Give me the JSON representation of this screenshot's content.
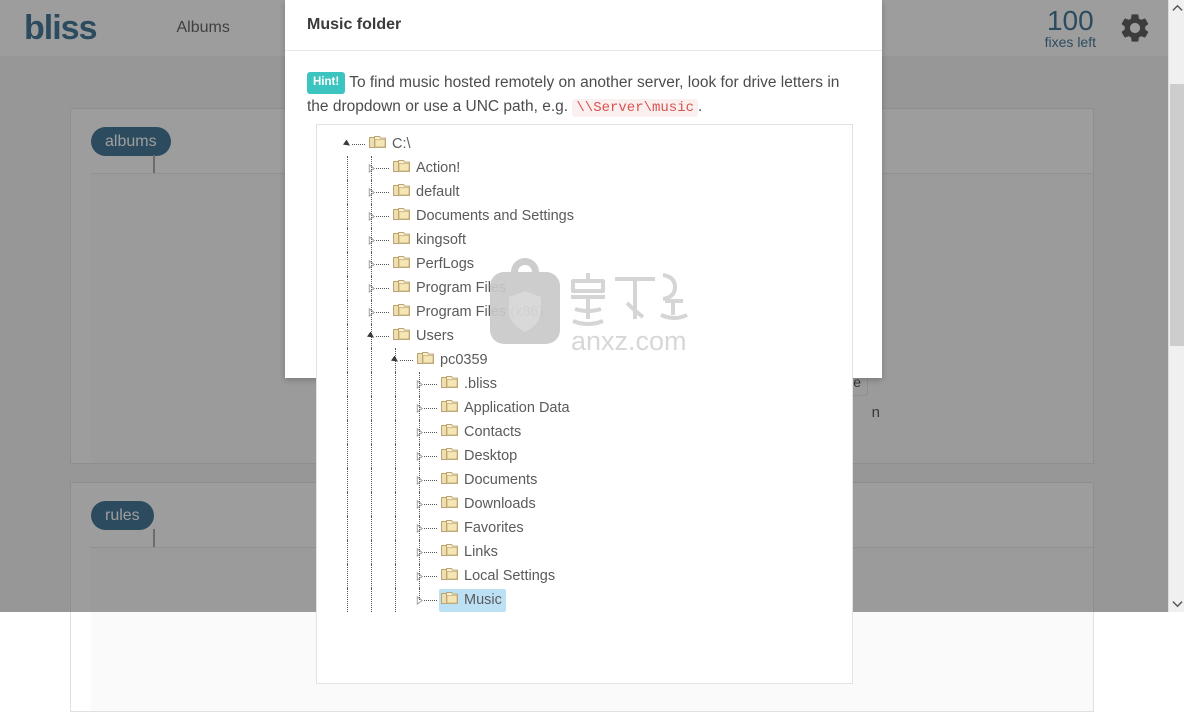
{
  "header": {
    "logo": "bliss",
    "nav_albums": "Albums",
    "fixes_count": "100",
    "fixes_label": "fixes left",
    "gear_icon": "gear-icon"
  },
  "page": {
    "albums_badge": "albums",
    "rules_badge": "rules",
    "bg_fragment_chip": "e",
    "bg_fragment_text": "n"
  },
  "modal": {
    "title": "Music folder",
    "hint_badge": "Hint!",
    "hint_text_before": "To find music hosted remotely on another server, look for drive letters in the dropdown or use a UNC path, e.g.",
    "hint_code": "\\\\Server\\music",
    "hint_text_after": "."
  },
  "tree": {
    "nodes": [
      {
        "label": "C:\\",
        "depth": 0,
        "state": "expanded",
        "selected": false
      },
      {
        "label": "Action!",
        "depth": 1,
        "state": "collapsed",
        "selected": false
      },
      {
        "label": "default",
        "depth": 1,
        "state": "collapsed",
        "selected": false
      },
      {
        "label": "Documents and Settings",
        "depth": 1,
        "state": "collapsed",
        "selected": false
      },
      {
        "label": "kingsoft",
        "depth": 1,
        "state": "collapsed",
        "selected": false
      },
      {
        "label": "PerfLogs",
        "depth": 1,
        "state": "collapsed",
        "selected": false
      },
      {
        "label": "Program Files",
        "depth": 1,
        "state": "collapsed",
        "selected": false
      },
      {
        "label": "Program Files (x86)",
        "depth": 1,
        "state": "collapsed",
        "selected": false
      },
      {
        "label": "Users",
        "depth": 1,
        "state": "expanded",
        "selected": false
      },
      {
        "label": "pc0359",
        "depth": 2,
        "state": "expanded",
        "selected": false
      },
      {
        "label": ".bliss",
        "depth": 3,
        "state": "collapsed",
        "selected": false
      },
      {
        "label": "Application Data",
        "depth": 3,
        "state": "collapsed",
        "selected": false
      },
      {
        "label": "Contacts",
        "depth": 3,
        "state": "collapsed",
        "selected": false
      },
      {
        "label": "Desktop",
        "depth": 3,
        "state": "collapsed",
        "selected": false
      },
      {
        "label": "Documents",
        "depth": 3,
        "state": "collapsed",
        "selected": false
      },
      {
        "label": "Downloads",
        "depth": 3,
        "state": "collapsed",
        "selected": false
      },
      {
        "label": "Favorites",
        "depth": 3,
        "state": "collapsed",
        "selected": false
      },
      {
        "label": "Links",
        "depth": 3,
        "state": "collapsed",
        "selected": false
      },
      {
        "label": "Local Settings",
        "depth": 3,
        "state": "collapsed",
        "selected": false
      },
      {
        "label": "Music",
        "depth": 3,
        "state": "collapsed",
        "selected": true
      }
    ]
  },
  "watermark": {
    "cn_text": "安下载",
    "domain_text": "anxz.com"
  },
  "scrollbar": {
    "up_icon": "chevron-up-icon",
    "down_icon": "chevron-down-icon"
  },
  "colors": {
    "brand": "#1d5b82",
    "hint_badge": "#3bc4c0",
    "code_red": "#d9534f",
    "selection": "#bce1f5"
  }
}
